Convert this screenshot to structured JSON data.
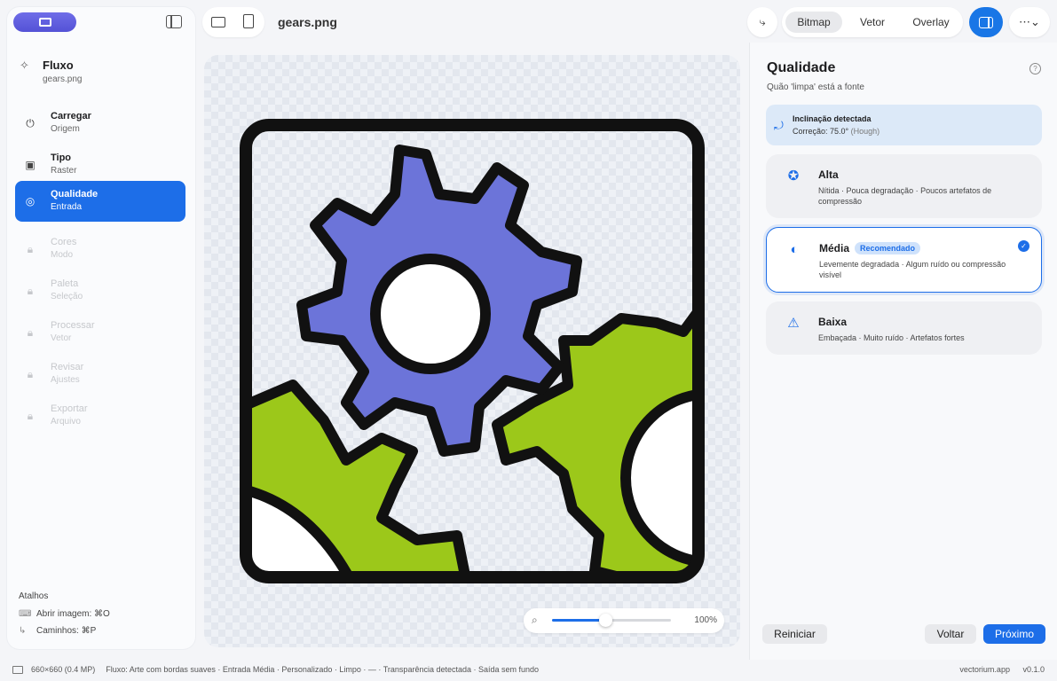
{
  "file": {
    "name": "gears.png"
  },
  "sidebar": {
    "flow_title": "Fluxo",
    "flow_subtitle": "gears.png",
    "steps": [
      {
        "title": "Carregar",
        "subtitle": "Origem",
        "state": "done",
        "icon": "upload-icon"
      },
      {
        "title": "Tipo",
        "subtitle": "Raster",
        "state": "done",
        "icon": "image-icon"
      },
      {
        "title": "Qualidade",
        "subtitle": "Entrada",
        "state": "active",
        "icon": "quality-icon"
      },
      {
        "title": "Cores",
        "subtitle": "Modo",
        "state": "locked",
        "icon": "lock-icon"
      },
      {
        "title": "Paleta",
        "subtitle": "Seleção",
        "state": "locked",
        "icon": "lock-icon"
      },
      {
        "title": "Processar",
        "subtitle": "Vetor",
        "state": "locked",
        "icon": "lock-icon"
      },
      {
        "title": "Revisar",
        "subtitle": "Ajustes",
        "state": "locked",
        "icon": "lock-icon"
      },
      {
        "title": "Exportar",
        "subtitle": "Arquivo",
        "state": "locked",
        "icon": "lock-icon"
      }
    ],
    "shortcuts_title": "Atalhos",
    "shortcuts": [
      {
        "label": "Abrir imagem: ⌘O",
        "icon": "keyboard-icon"
      },
      {
        "label": "Caminhos: ⌘P",
        "icon": "path-icon"
      }
    ]
  },
  "toolbar": {
    "view_modes": [
      "Bitmap",
      "Vetor",
      "Overlay"
    ],
    "active_mode": "Bitmap"
  },
  "zoom": {
    "label": "100%",
    "level": 0.45
  },
  "panel": {
    "title": "Qualidade",
    "subtitle": "Quão 'limpa' está a fonte",
    "notice": {
      "title": "Inclinação detectada",
      "text": "Correção: 75.0°",
      "method": "(Hough)"
    },
    "options": [
      {
        "title": "Alta",
        "desc": "Nítida · Pouca degradação · Poucos artefatos de compressão",
        "icon": "badge-check-icon",
        "selected": false
      },
      {
        "title": "Média",
        "badge": "Recomendado",
        "desc": "Levemente degradada · Algum ruído ou compressão visível",
        "icon": "half-circle-icon",
        "selected": true
      },
      {
        "title": "Baixa",
        "desc": "Embaçada · Muito ruído · Artefatos fortes",
        "icon": "warning-icon",
        "selected": false
      }
    ],
    "buttons": {
      "reset": "Reiniciar",
      "back": "Voltar",
      "next": "Próximo"
    }
  },
  "status": {
    "dimensions": "660×660 (0.4 MP)",
    "flow": "Fluxo: Arte com bordas suaves · Entrada Média · Personalizado · Limpo · — · Transparência detectada · Saída sem fundo",
    "app": "vectorium.app",
    "version": "v0.1.0"
  },
  "colors": {
    "accent": "#1d6ee8",
    "gear_blue": "#6c74d9",
    "gear_green": "#9cc81a"
  }
}
